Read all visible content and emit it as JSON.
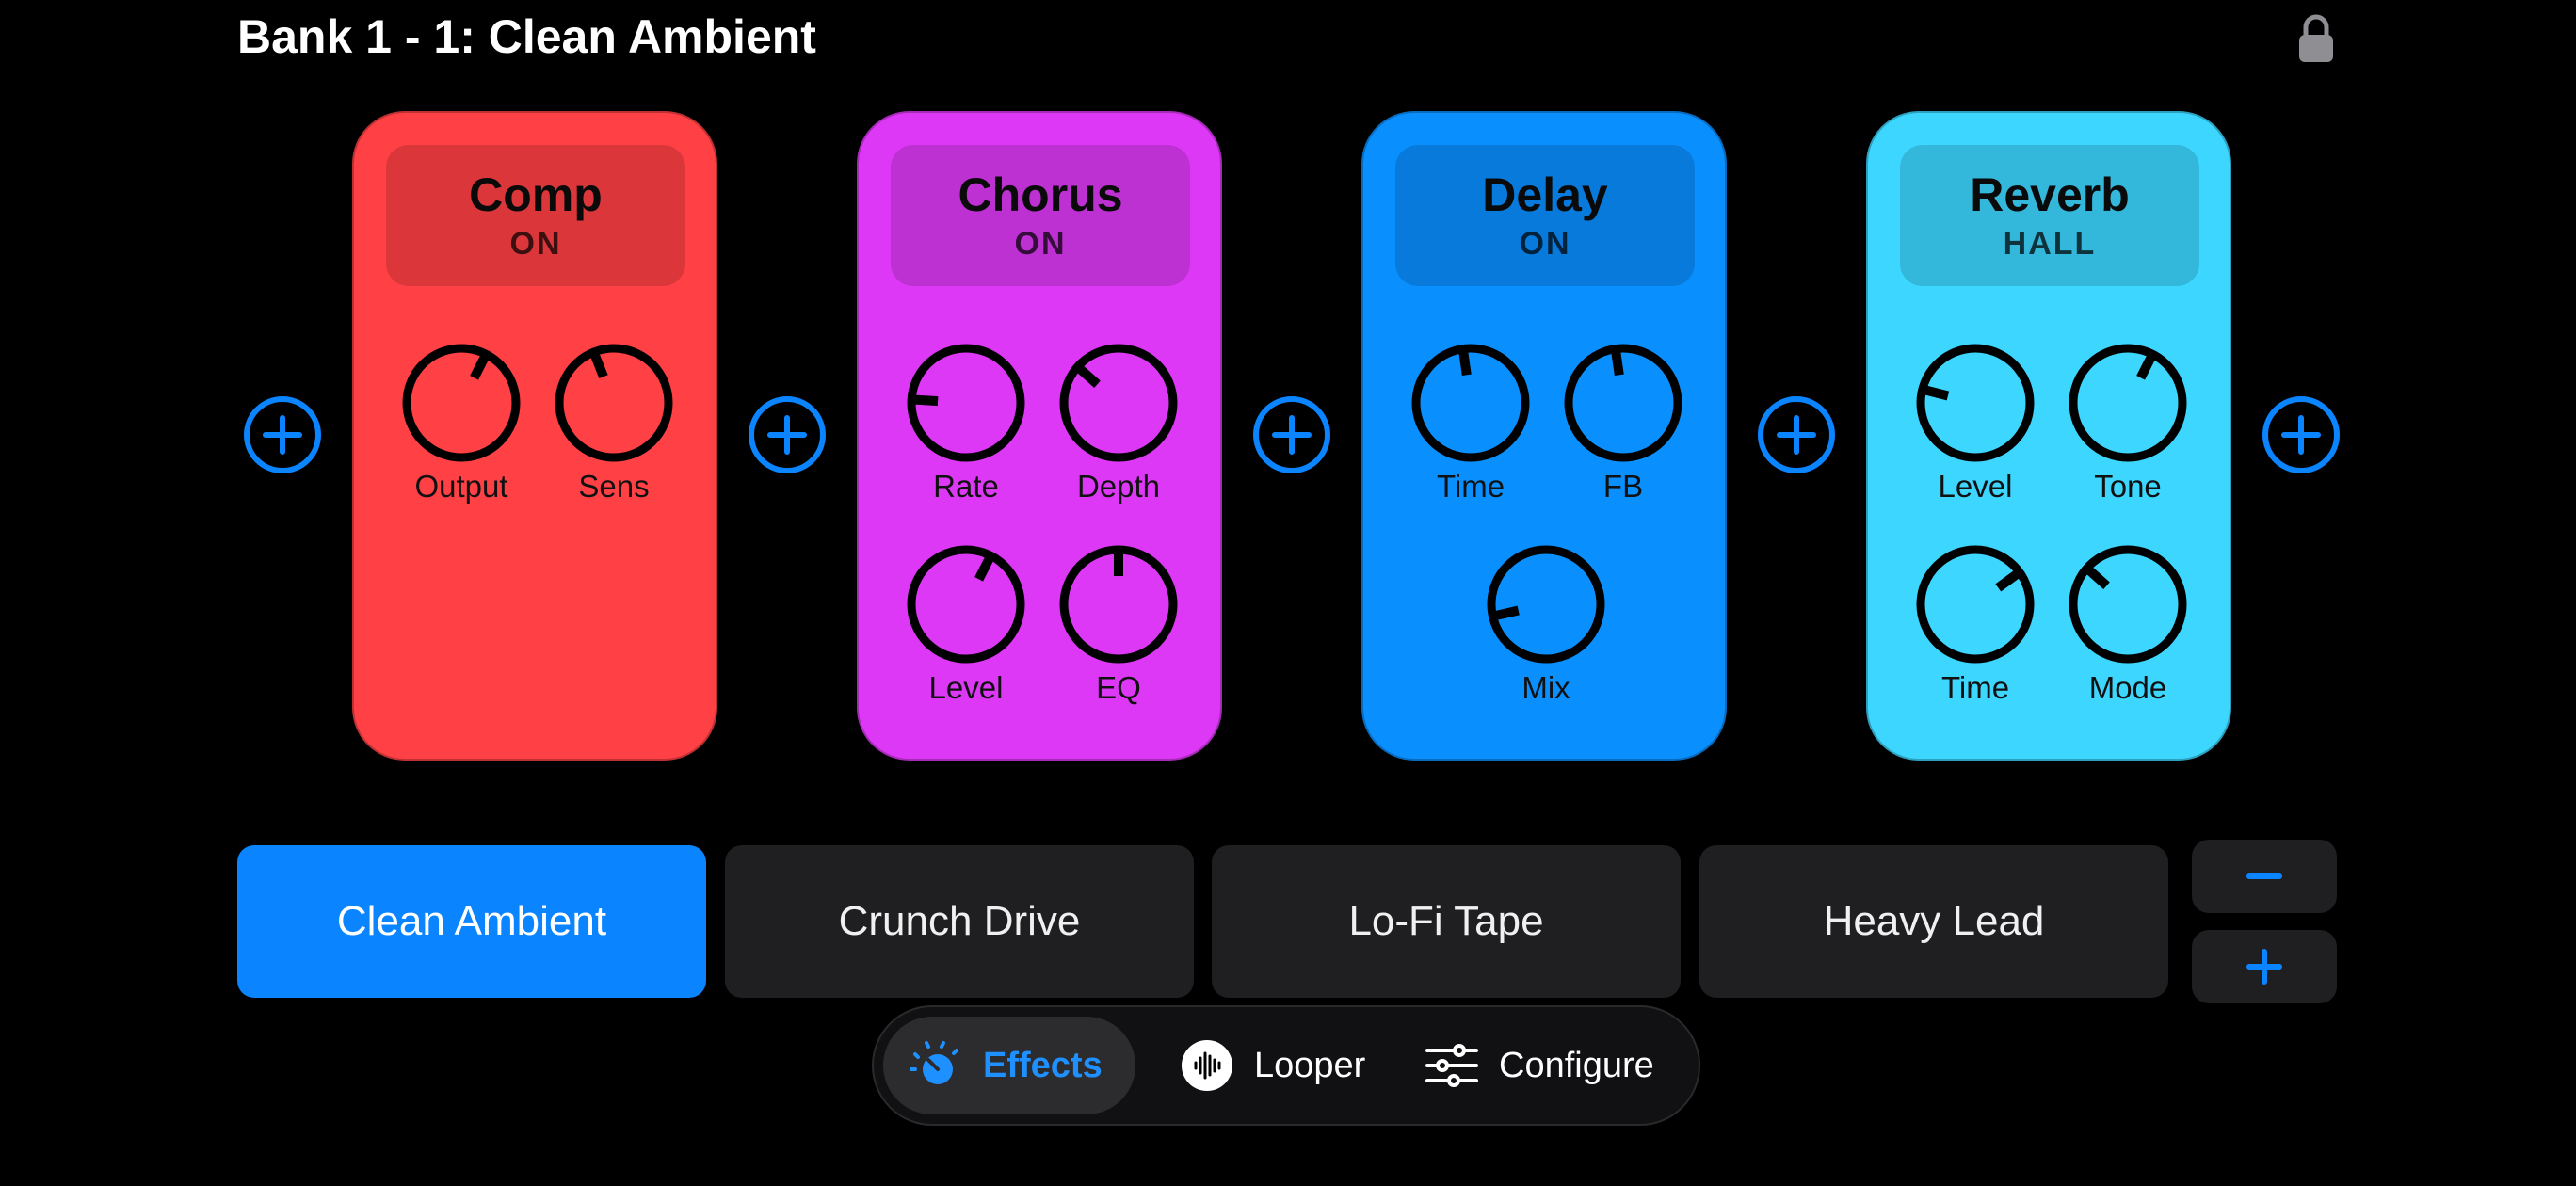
{
  "header": {
    "title": "Bank 1 - 1: Clean Ambient"
  },
  "colors": {
    "comp": "#ff4044",
    "chorus": "#dd38f5",
    "delay": "#0a8fff",
    "reverb": "#3cd6ff",
    "accent": "#0a84ff",
    "knob": "#000000"
  },
  "pedals": [
    {
      "name": "Comp",
      "status": "ON",
      "knobs": [
        {
          "label": "Output",
          "value": 0.6
        },
        {
          "label": "Sens",
          "value": 0.42
        }
      ]
    },
    {
      "name": "Chorus",
      "status": "ON",
      "knobs": [
        {
          "label": "Rate",
          "value": 0.18
        },
        {
          "label": "Depth",
          "value": 0.32
        },
        {
          "label": "Level",
          "value": 0.6
        },
        {
          "label": "EQ",
          "value": 0.5
        }
      ]
    },
    {
      "name": "Delay",
      "status": "ON",
      "knobs": [
        {
          "label": "Time",
          "value": 0.47
        },
        {
          "label": "FB",
          "value": 0.47
        },
        {
          "label": "Mix",
          "value": 0.12
        }
      ]
    },
    {
      "name": "Reverb",
      "status": "HALL",
      "knobs": [
        {
          "label": "Level",
          "value": 0.22
        },
        {
          "label": "Tone",
          "value": 0.6
        },
        {
          "label": "Time",
          "value": 0.7
        },
        {
          "label": "Mode",
          "value": 0.32
        }
      ]
    }
  ],
  "presets": [
    {
      "label": "Clean Ambient",
      "active": true
    },
    {
      "label": "Crunch Drive",
      "active": false
    },
    {
      "label": "Lo-Fi Tape",
      "active": false
    },
    {
      "label": "Heavy Lead",
      "active": false
    }
  ],
  "bank_controls": {
    "minus_icon": "minus-icon",
    "plus_icon": "plus-icon"
  },
  "tabs": [
    {
      "label": "Effects",
      "icon": "knob-icon",
      "selected": true
    },
    {
      "label": "Looper",
      "icon": "waveform-icon",
      "selected": false
    },
    {
      "label": "Configure",
      "icon": "sliders-icon",
      "selected": false
    }
  ]
}
